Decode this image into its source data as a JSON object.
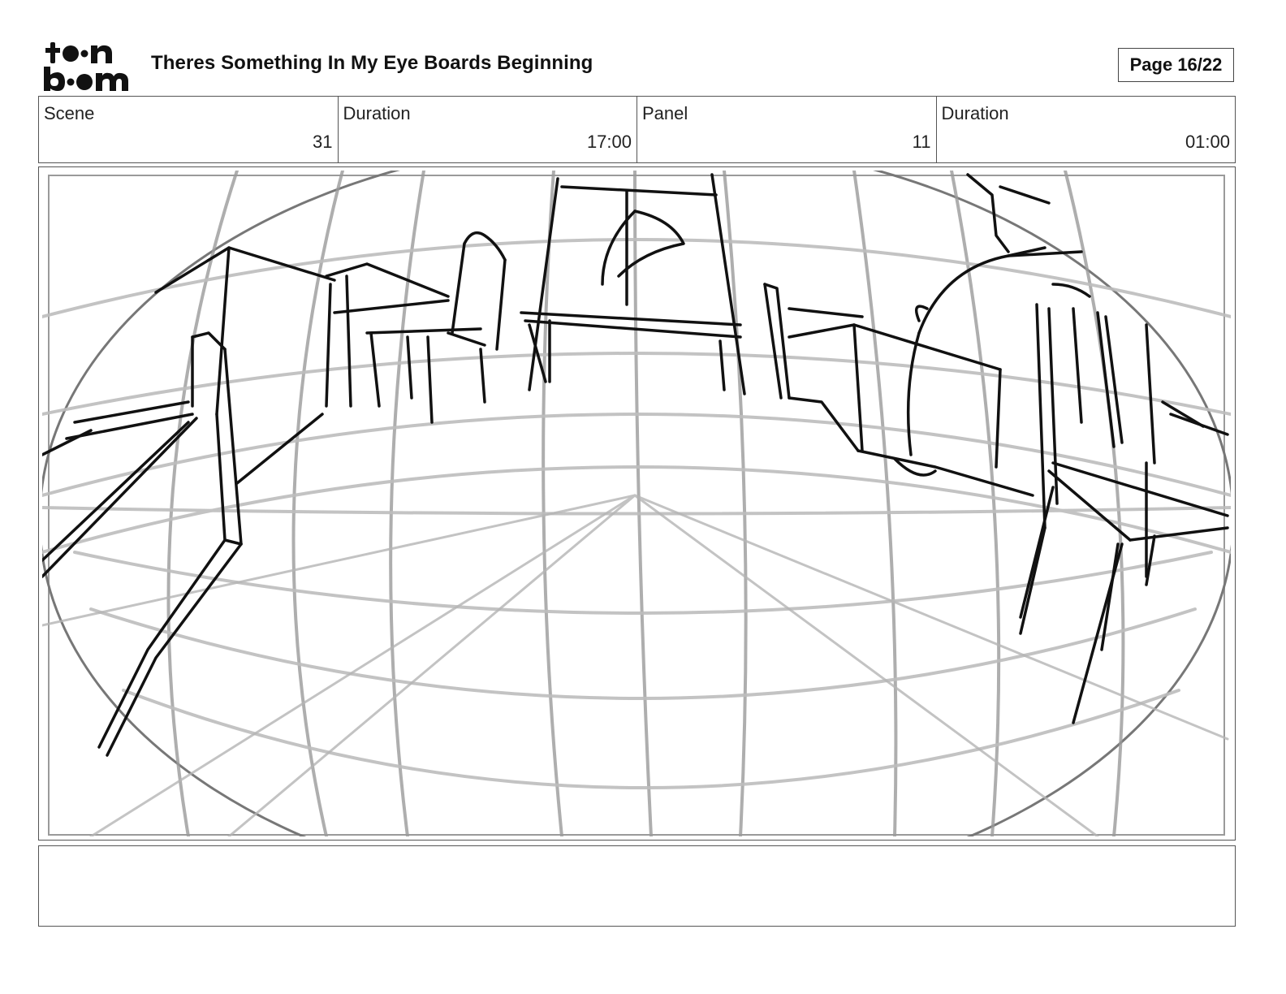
{
  "header": {
    "logo_alt": "toon boom",
    "title": "Theres Something In My Eye Boards Beginning",
    "page_label": "Page 16/22"
  },
  "info": [
    {
      "label": "Scene",
      "value": "31"
    },
    {
      "label": "Duration",
      "value": "17:00"
    },
    {
      "label": "Panel",
      "value": "11"
    },
    {
      "label": "Duration",
      "value": "01:00"
    }
  ],
  "panel": {
    "icon": "storyboard-sketch-fisheye-room"
  },
  "caption": {
    "text": ""
  },
  "colors": {
    "ink": "#111111",
    "guide": "#9a9a9a",
    "border": "#555555"
  }
}
